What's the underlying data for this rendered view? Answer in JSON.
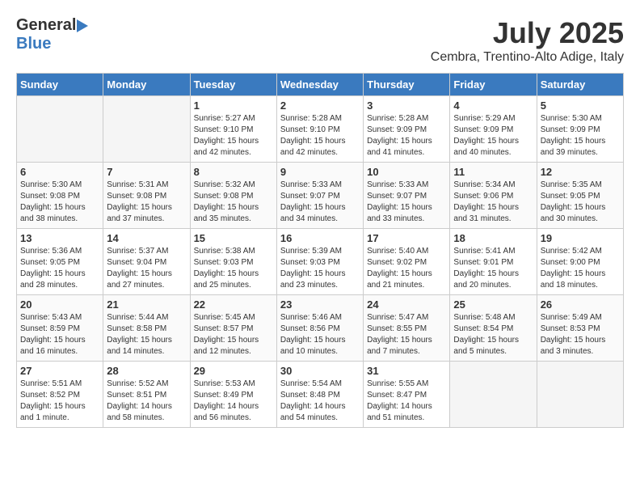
{
  "header": {
    "logo_general": "General",
    "logo_blue": "Blue",
    "month_title": "July 2025",
    "location": "Cembra, Trentino-Alto Adige, Italy"
  },
  "days_of_week": [
    "Sunday",
    "Monday",
    "Tuesday",
    "Wednesday",
    "Thursday",
    "Friday",
    "Saturday"
  ],
  "weeks": [
    [
      {
        "day": "",
        "empty": true
      },
      {
        "day": "",
        "empty": true
      },
      {
        "day": "1",
        "sunrise": "5:27 AM",
        "sunset": "9:10 PM",
        "daylight": "15 hours and 42 minutes."
      },
      {
        "day": "2",
        "sunrise": "5:28 AM",
        "sunset": "9:10 PM",
        "daylight": "15 hours and 42 minutes."
      },
      {
        "day": "3",
        "sunrise": "5:28 AM",
        "sunset": "9:09 PM",
        "daylight": "15 hours and 41 minutes."
      },
      {
        "day": "4",
        "sunrise": "5:29 AM",
        "sunset": "9:09 PM",
        "daylight": "15 hours and 40 minutes."
      },
      {
        "day": "5",
        "sunrise": "5:30 AM",
        "sunset": "9:09 PM",
        "daylight": "15 hours and 39 minutes."
      }
    ],
    [
      {
        "day": "6",
        "sunrise": "5:30 AM",
        "sunset": "9:08 PM",
        "daylight": "15 hours and 38 minutes."
      },
      {
        "day": "7",
        "sunrise": "5:31 AM",
        "sunset": "9:08 PM",
        "daylight": "15 hours and 37 minutes."
      },
      {
        "day": "8",
        "sunrise": "5:32 AM",
        "sunset": "9:08 PM",
        "daylight": "15 hours and 35 minutes."
      },
      {
        "day": "9",
        "sunrise": "5:33 AM",
        "sunset": "9:07 PM",
        "daylight": "15 hours and 34 minutes."
      },
      {
        "day": "10",
        "sunrise": "5:33 AM",
        "sunset": "9:07 PM",
        "daylight": "15 hours and 33 minutes."
      },
      {
        "day": "11",
        "sunrise": "5:34 AM",
        "sunset": "9:06 PM",
        "daylight": "15 hours and 31 minutes."
      },
      {
        "day": "12",
        "sunrise": "5:35 AM",
        "sunset": "9:05 PM",
        "daylight": "15 hours and 30 minutes."
      }
    ],
    [
      {
        "day": "13",
        "sunrise": "5:36 AM",
        "sunset": "9:05 PM",
        "daylight": "15 hours and 28 minutes."
      },
      {
        "day": "14",
        "sunrise": "5:37 AM",
        "sunset": "9:04 PM",
        "daylight": "15 hours and 27 minutes."
      },
      {
        "day": "15",
        "sunrise": "5:38 AM",
        "sunset": "9:03 PM",
        "daylight": "15 hours and 25 minutes."
      },
      {
        "day": "16",
        "sunrise": "5:39 AM",
        "sunset": "9:03 PM",
        "daylight": "15 hours and 23 minutes."
      },
      {
        "day": "17",
        "sunrise": "5:40 AM",
        "sunset": "9:02 PM",
        "daylight": "15 hours and 21 minutes."
      },
      {
        "day": "18",
        "sunrise": "5:41 AM",
        "sunset": "9:01 PM",
        "daylight": "15 hours and 20 minutes."
      },
      {
        "day": "19",
        "sunrise": "5:42 AM",
        "sunset": "9:00 PM",
        "daylight": "15 hours and 18 minutes."
      }
    ],
    [
      {
        "day": "20",
        "sunrise": "5:43 AM",
        "sunset": "8:59 PM",
        "daylight": "15 hours and 16 minutes."
      },
      {
        "day": "21",
        "sunrise": "5:44 AM",
        "sunset": "8:58 PM",
        "daylight": "15 hours and 14 minutes."
      },
      {
        "day": "22",
        "sunrise": "5:45 AM",
        "sunset": "8:57 PM",
        "daylight": "15 hours and 12 minutes."
      },
      {
        "day": "23",
        "sunrise": "5:46 AM",
        "sunset": "8:56 PM",
        "daylight": "15 hours and 10 minutes."
      },
      {
        "day": "24",
        "sunrise": "5:47 AM",
        "sunset": "8:55 PM",
        "daylight": "15 hours and 7 minutes."
      },
      {
        "day": "25",
        "sunrise": "5:48 AM",
        "sunset": "8:54 PM",
        "daylight": "15 hours and 5 minutes."
      },
      {
        "day": "26",
        "sunrise": "5:49 AM",
        "sunset": "8:53 PM",
        "daylight": "15 hours and 3 minutes."
      }
    ],
    [
      {
        "day": "27",
        "sunrise": "5:51 AM",
        "sunset": "8:52 PM",
        "daylight": "15 hours and 1 minute."
      },
      {
        "day": "28",
        "sunrise": "5:52 AM",
        "sunset": "8:51 PM",
        "daylight": "14 hours and 58 minutes."
      },
      {
        "day": "29",
        "sunrise": "5:53 AM",
        "sunset": "8:49 PM",
        "daylight": "14 hours and 56 minutes."
      },
      {
        "day": "30",
        "sunrise": "5:54 AM",
        "sunset": "8:48 PM",
        "daylight": "14 hours and 54 minutes."
      },
      {
        "day": "31",
        "sunrise": "5:55 AM",
        "sunset": "8:47 PM",
        "daylight": "14 hours and 51 minutes."
      },
      {
        "day": "",
        "empty": true
      },
      {
        "day": "",
        "empty": true
      }
    ]
  ]
}
